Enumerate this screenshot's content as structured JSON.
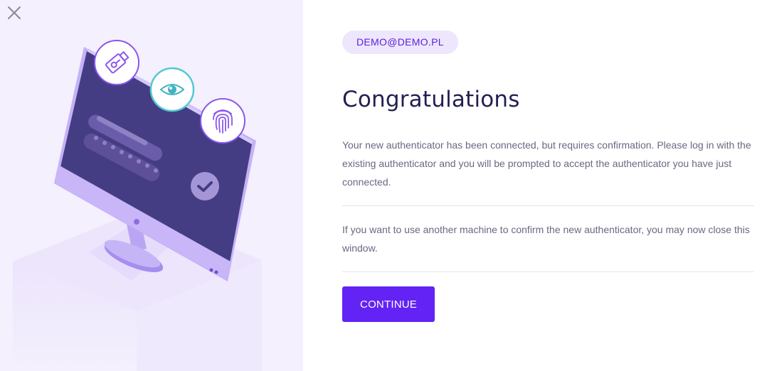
{
  "header": {
    "close_icon": "close-icon"
  },
  "main": {
    "email": "DEMO@DEMO.PL",
    "title": "Congratulations",
    "message_confirm": "Your new authenticator has been connected, but requires confirmation. Please log in with the existing authenticator and you will be prompted to accept the authenticator you have just connected.",
    "message_close": "If you want to use another machine to confirm the new authenticator, you may now close this window.",
    "continue_label": "CONTINUE"
  },
  "illustration": {
    "icons": [
      "usb-key-icon",
      "eye-icon",
      "fingerprint-icon",
      "checkmark-icon"
    ]
  },
  "colors": {
    "accent": "#6223f4",
    "badge_bg": "#ede6fd",
    "title": "#231f52",
    "left_panel_bg": "#f4f0fd"
  }
}
